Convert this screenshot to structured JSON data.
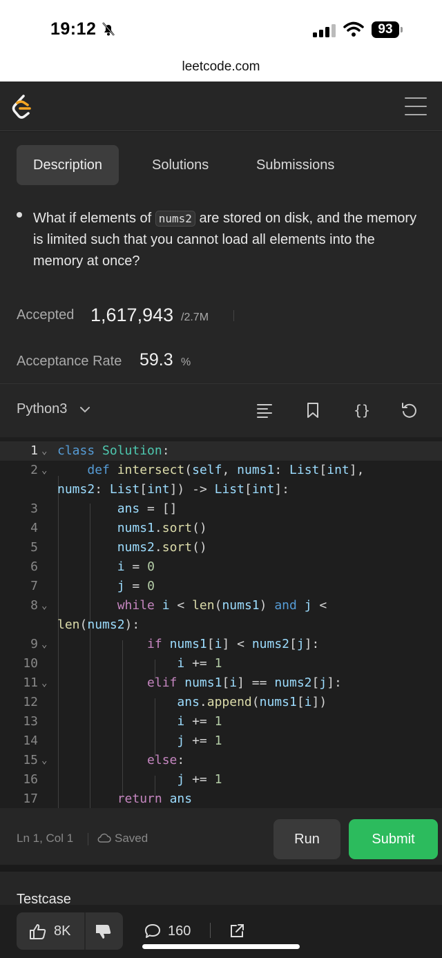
{
  "status_bar": {
    "time": "19:12",
    "battery": "93"
  },
  "browser": {
    "url": "leetcode.com"
  },
  "tabs": [
    {
      "label": "Description",
      "active": true
    },
    {
      "label": "Solutions",
      "active": false
    },
    {
      "label": "Submissions",
      "active": false
    }
  ],
  "description": {
    "bullet_before": "What if elements of ",
    "bullet_code": "nums2",
    "bullet_after": " are stored on disk, and the memory is limited such that you cannot load all elements into the memory at once?",
    "accepted_label": "Accepted",
    "accepted_value": "1,617,943",
    "accepted_total": "/2.7M",
    "rate_label": "Acceptance Rate",
    "rate_value": "59.3",
    "rate_unit": "%"
  },
  "editor": {
    "language": "Python3",
    "position": "Ln 1, Col 1",
    "saved": "Saved",
    "run_label": "Run",
    "submit_label": "Submit",
    "line_numbers": [
      "1",
      "2",
      "",
      "3",
      "4",
      "5",
      "6",
      "7",
      "8",
      "",
      "9",
      "10",
      "11",
      "12",
      "13",
      "14",
      "15",
      "16",
      "17"
    ]
  },
  "testcase": {
    "title": "Testcase"
  },
  "actions": {
    "likes": "8K",
    "comments": "160"
  },
  "colors": {
    "accent": "#2cbb5d",
    "background": "#262626",
    "code_bg": "#1e1e1e"
  }
}
